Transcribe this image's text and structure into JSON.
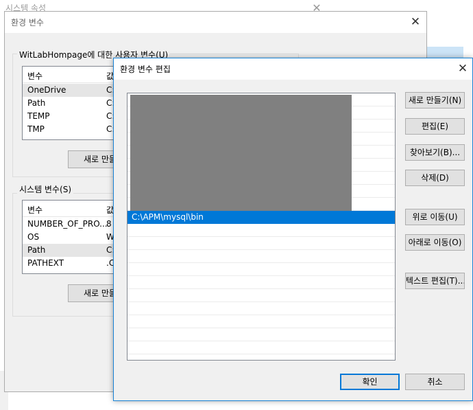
{
  "system_props": {
    "title": "시스템 속성"
  },
  "env_vars": {
    "title": "환경 변수",
    "user_group_label": "WitLabHompage에 대한 사용자 변수(U)",
    "user_vars": {
      "col_name": "변수",
      "col_value": "값",
      "rows": [
        {
          "name": "OneDrive",
          "value": "C:"
        },
        {
          "name": "Path",
          "value": "C:"
        },
        {
          "name": "TEMP",
          "value": "C:"
        },
        {
          "name": "TMP",
          "value": "C:"
        }
      ]
    },
    "user_new_button": "새로 만들",
    "system_group_label": "시스템 변수(S)",
    "system_vars": {
      "col_name": "변수",
      "col_value": "값",
      "rows": [
        {
          "name": "NUMBER_OF_PRO...",
          "value": "8"
        },
        {
          "name": "OS",
          "value": "W"
        },
        {
          "name": "Path",
          "value": "C:"
        },
        {
          "name": "PATHEXT",
          "value": ".C"
        }
      ]
    },
    "system_new_button": "새로 만들"
  },
  "edit_dialog": {
    "title": "환경 변수 편집",
    "selected_entry": "C:\\APM\\mysql\\bin",
    "buttons": {
      "new": "새로 만들기(N)",
      "edit": "편집(E)",
      "browse": "찾아보기(B)...",
      "delete": "삭제(D)",
      "move_up": "위로 이동(U)",
      "move_down": "아래로 이동(O)",
      "edit_text": "텍스트 편집(T)...",
      "ok": "확인",
      "cancel": "취소"
    }
  },
  "colors": {
    "selection": "#0078d7",
    "redacted_block": "#808080"
  }
}
